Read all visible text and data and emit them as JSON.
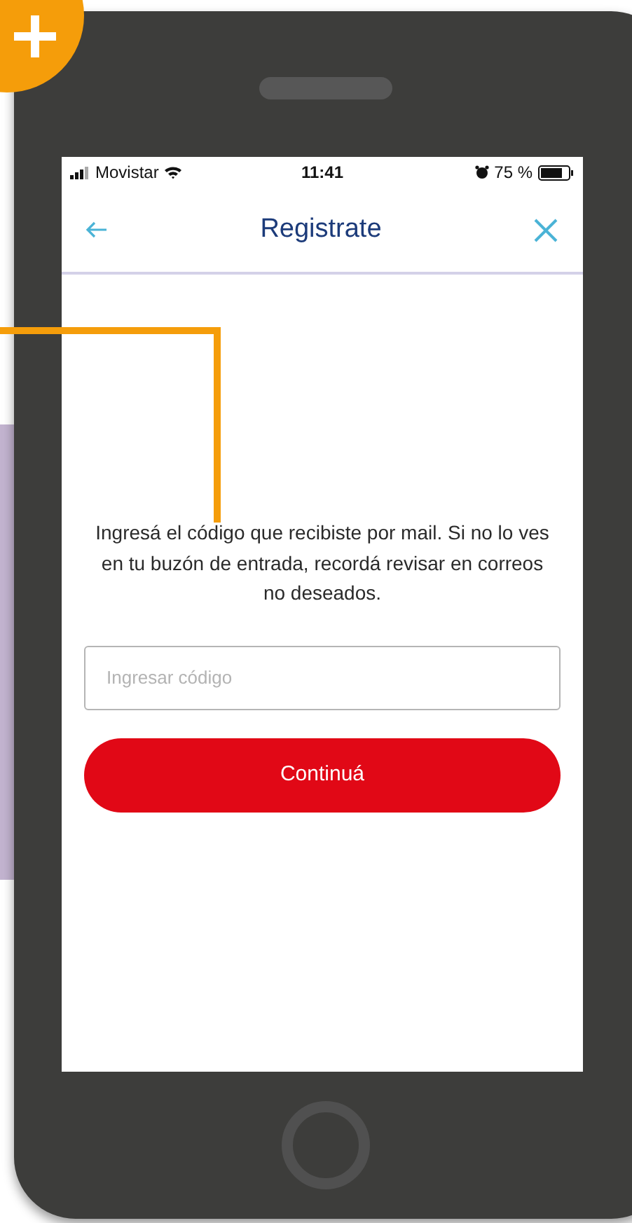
{
  "status_bar": {
    "carrier": "Movistar",
    "time": "11:41",
    "battery": "75 %"
  },
  "header": {
    "title": "Registrate"
  },
  "message": "Ingresá el código que recibiste por mail. Si no lo ves en tu buzón de entrada, recordá revisar en correos no deseados.",
  "code_field": {
    "placeholder": "Ingresar código"
  },
  "continue_button": {
    "label": "Continuá"
  }
}
